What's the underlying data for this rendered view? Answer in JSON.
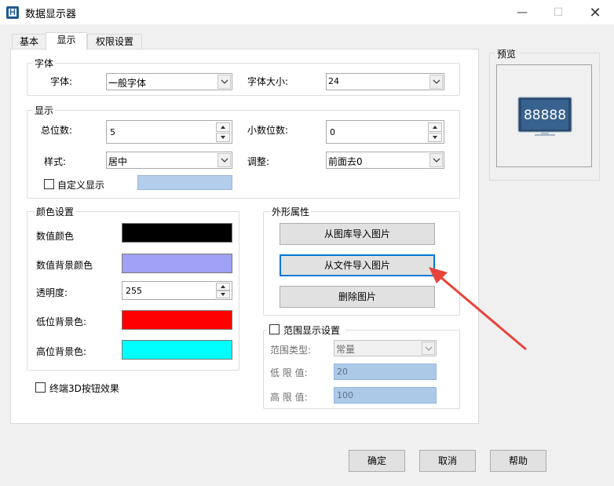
{
  "window": {
    "title": "数据显示器",
    "minimize": "—",
    "maximize": "☐",
    "close": "✕"
  },
  "tabs": [
    {
      "label": "基本"
    },
    {
      "label": "显示"
    },
    {
      "label": "权限设置"
    }
  ],
  "font_group": {
    "title": "字体",
    "font_label": "字体:",
    "font_value": "一般字体",
    "size_label": "字体大小:",
    "size_value": "24"
  },
  "display_group": {
    "title": "显示",
    "total_digits_label": "总位数:",
    "total_digits_value": "5",
    "decimal_label": "小数位数:",
    "decimal_value": "0",
    "style_label": "样式:",
    "style_value": "居中",
    "adjust_label": "调整:",
    "adjust_value": "前面去0",
    "custom_label": "自定义显示",
    "custom_color": "#b4cdea"
  },
  "color_group": {
    "title": "颜色设置",
    "value_color_label": "数值颜色",
    "value_color": "#000000",
    "bg_color_label": "数值背景颜色",
    "bg_color": "#a1a1f5",
    "opacity_label": "透明度:",
    "opacity_value": "255",
    "low_bg_label": "低位背景色:",
    "low_bg_color": "#ff0000",
    "high_bg_label": "高位背景色:",
    "high_bg_color": "#00ffff"
  },
  "shape_group": {
    "title": "外形属性",
    "import_library": "从图库导入图片",
    "import_file": "从文件导入图片",
    "delete_image": "删除图片"
  },
  "range_group": {
    "title": "范围显示设置",
    "type_label": "范围类型:",
    "type_value": "常量",
    "low_label": "低 限 值:",
    "low_value": "20",
    "high_label": "高 限 值:",
    "high_value": "100"
  },
  "terminal_3d_label": "终端3D按钮效果",
  "preview": {
    "title": "预览",
    "sample_text": "88888"
  },
  "footer": {
    "ok": "确定",
    "cancel": "取消",
    "help": "帮助"
  },
  "colors": {
    "accent": "#0078d7",
    "arrow": "#e8443a"
  }
}
